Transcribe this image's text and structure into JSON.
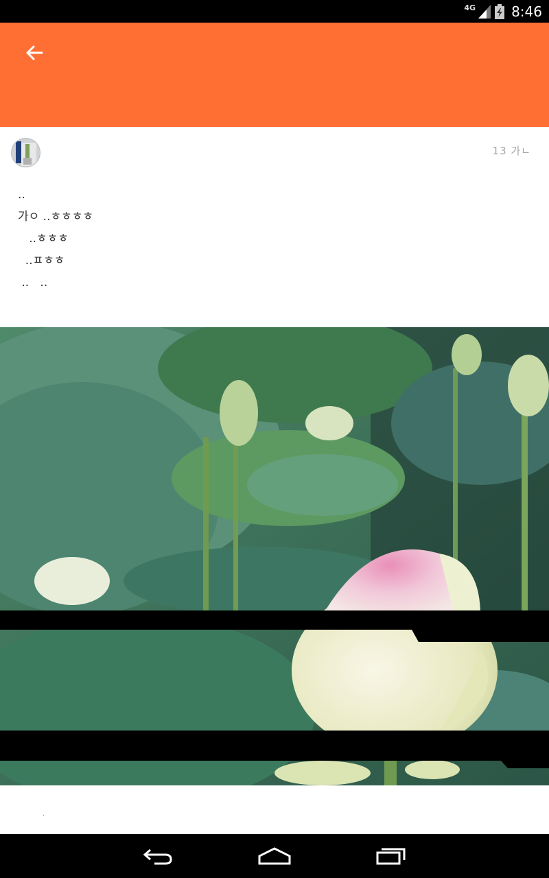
{
  "status_bar": {
    "network": "4G",
    "time": "8:46"
  },
  "action_bar": {
    "back_icon": "arrow-left-icon",
    "color": "#ff6f34"
  },
  "post": {
    "timestamp": "13 가ㄴ",
    "body_lines": [
      "..",
      "가ㅇ ..ㅎㅎㅎㅎ",
      "   ..ㅎㅎㅎ",
      "  ..ㅍㅎㅎ",
      " ..   .."
    ]
  },
  "photo": {
    "subject": "lotus-flower-photo"
  },
  "footer": {
    "text": "."
  },
  "nav_bar": {
    "back": "back-icon",
    "home": "home-icon",
    "recents": "recents-icon"
  }
}
